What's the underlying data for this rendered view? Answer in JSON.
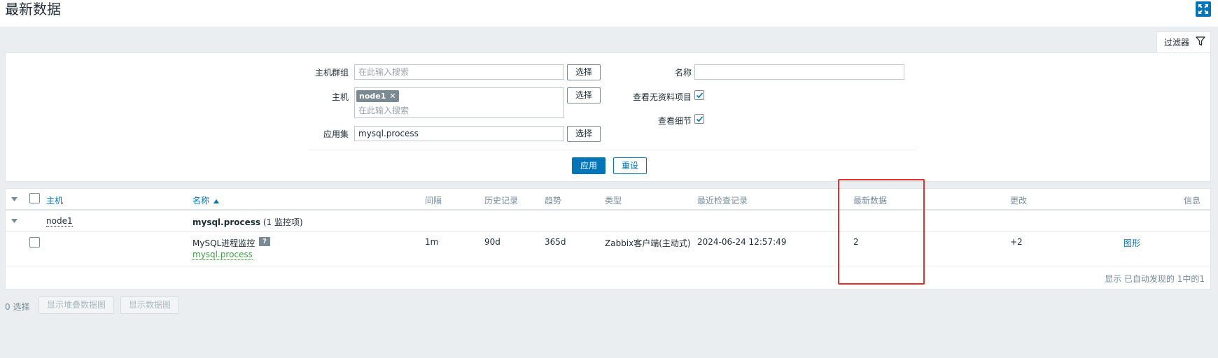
{
  "page": {
    "title": "最新数据"
  },
  "filter": {
    "tab_label": "过滤器",
    "host_group_label": "主机群组",
    "host_group_placeholder": "在此输入搜索",
    "select_label": "选择",
    "host_label": "主机",
    "host_tag": "node1",
    "host_placeholder": "在此输入搜索",
    "application_label": "应用集",
    "application_value": "mysql.process",
    "name_label": "名称",
    "name_value": "",
    "show_without_data_label": "查看无资料项目",
    "show_without_data_checked": true,
    "show_details_label": "查看细节",
    "show_details_checked": true,
    "apply_label": "应用",
    "reset_label": "重设"
  },
  "table": {
    "columns": {
      "host": "主机",
      "name": "名称",
      "interval": "间隔",
      "history": "历史记录",
      "trends": "趋势",
      "type": "类型",
      "last_check": "最近检查记录",
      "last_value": "最新数据",
      "change": "更改",
      "info": "信息"
    },
    "group_row": {
      "host": "node1",
      "application": "mysql.process",
      "count": "(1 监控项)"
    },
    "rows": [
      {
        "name": "MySQL进程监控",
        "help": "?",
        "application": "mysql.process",
        "interval": "1m",
        "history": "90d",
        "trends": "365d",
        "type": "Zabbix客户端(主动式)",
        "last_check": "2024-06-24 12:57:49",
        "last_value": "2",
        "change": "+2",
        "graph_link": "图形"
      }
    ],
    "summary": "显示 已自动发现的 1中的1"
  },
  "footer": {
    "selected": "0 选择",
    "stacked_graph_button": "显示堆叠数据图",
    "graph_button": "显示数据图"
  },
  "colors": {
    "accent": "#0275b8",
    "highlight": "#e8302a",
    "green_link": "#429e47"
  }
}
